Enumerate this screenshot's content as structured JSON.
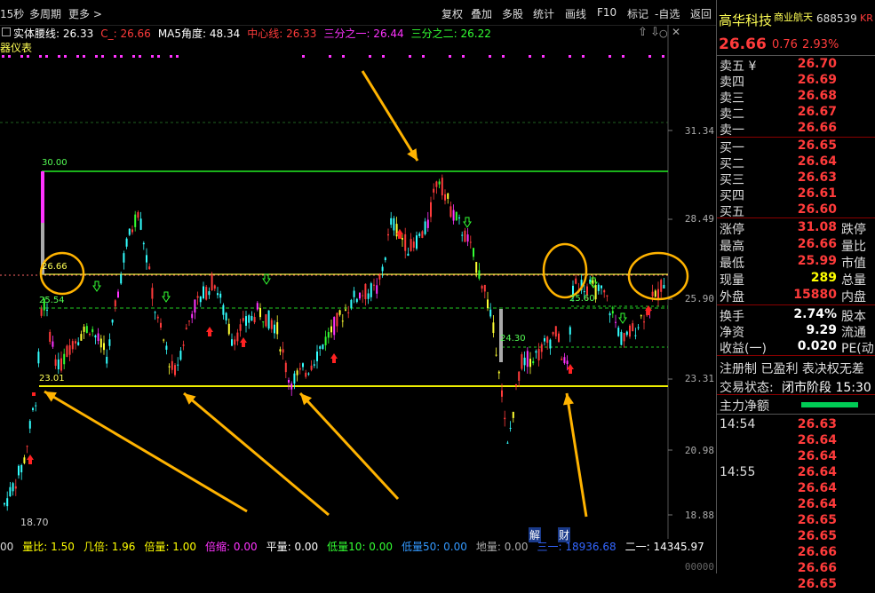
{
  "topbar": {
    "period": "15秒",
    "multi_period": "多周期",
    "more": "更多 >",
    "menu": [
      "复权",
      "叠加",
      "多股",
      "统计",
      "画线",
      "F10",
      "标记",
      "-自选",
      "返回"
    ]
  },
  "legend": {
    "items": [
      {
        "text": "实体腰线: 26.33",
        "color": "#ffffff"
      },
      {
        "text": "C_: 26.66",
        "color": "#ff3b3b"
      },
      {
        "text": "MA5角度: 48.34",
        "color": "#ffffff"
      },
      {
        "text": "中心线: 26.33",
        "color": "#ff3b3b"
      },
      {
        "text": "三分之一: 26.44",
        "color": "#ff33ff"
      },
      {
        "text": "三分之二: 26.22",
        "color": "#33ff33"
      }
    ],
    "panel_name": "器仪表"
  },
  "price_axis": [
    "31.34",
    "28.49",
    "25.90",
    "23.31",
    "20.98",
    "18.88"
  ],
  "price_axis_partial": "00000",
  "annotations": {
    "line_30": "30.00",
    "line_2666": "26.66",
    "line_2554": "25.54",
    "line_2301": "23.01",
    "low_1870": "18.70",
    "label_2430": "24.30",
    "label_2560": "25.60",
    "jie": "解",
    "cai": "财"
  },
  "bottombar": {
    "items": [
      {
        "text": "00",
        "color": "#dddddd"
      },
      {
        "text": "量比: 1.50",
        "color": "#ffff00"
      },
      {
        "text": "几倍: 1.96",
        "color": "#ffff00"
      },
      {
        "text": "倍量: 1.00",
        "color": "#ffff00"
      },
      {
        "text": "倍缩: 0.00",
        "color": "#ff33ff"
      },
      {
        "text": "平量: 0.00",
        "color": "#ffffff"
      },
      {
        "text": "低量10: 0.00",
        "color": "#33ff33"
      },
      {
        "text": "低量50: 0.00",
        "color": "#3399ff"
      },
      {
        "text": "地量: 0.00",
        "color": "#aaaaaa"
      },
      {
        "text": "三一: 18936.68",
        "color": "#3366ff"
      },
      {
        "text": "二一: 14345.97",
        "color": "#ffffff"
      }
    ]
  },
  "stock": {
    "name": "高华科技",
    "sector": "商业航天",
    "code": "688539",
    "suffix": "KR",
    "price": "26.66",
    "change": "0.76",
    "pct": "2.93%"
  },
  "orderbook": {
    "asks": [
      {
        "label": "卖五 ¥",
        "price": "26.70"
      },
      {
        "label": "卖四",
        "price": "26.69"
      },
      {
        "label": "卖三",
        "price": "26.68"
      },
      {
        "label": "卖二",
        "price": "26.67"
      },
      {
        "label": "卖一",
        "price": "26.66"
      }
    ],
    "bids": [
      {
        "label": "买一",
        "price": "26.65"
      },
      {
        "label": "买二",
        "price": "26.64"
      },
      {
        "label": "买三",
        "price": "26.63"
      },
      {
        "label": "买四",
        "price": "26.61"
      },
      {
        "label": "买五",
        "price": "26.60"
      }
    ]
  },
  "stats": [
    {
      "label": "涨停",
      "value": "31.08",
      "extra": "跌停",
      "color": "#ff3b3b"
    },
    {
      "label": "最高",
      "value": "26.66",
      "extra": "量比",
      "color": "#ff3b3b"
    },
    {
      "label": "最低",
      "value": "25.99",
      "extra": "市值",
      "color": "#ff3b3b"
    },
    {
      "label": "现量",
      "value": "289",
      "extra": "总量",
      "color": "#ffff00"
    },
    {
      "label": "外盘",
      "value": "15880",
      "extra": "内盘",
      "color": "#ff3b3b"
    }
  ],
  "stats2": [
    {
      "label": "换手",
      "value": "2.74%",
      "extra": "股本",
      "color": "#ffffff"
    },
    {
      "label": "净资",
      "value": "9.29",
      "extra": "流通",
      "color": "#ffffff"
    },
    {
      "label": "收益(一)",
      "value": "0.020",
      "extra": "PE(动)",
      "color": "#ffffff"
    }
  ],
  "notice": "注册制 已盈利 表决权无差",
  "trade_state": {
    "label": "交易状态:",
    "value": "闭市阶段 15:30"
  },
  "main_flow": "主力净额",
  "ticks": [
    {
      "time": "14:54",
      "price": "26.63"
    },
    {
      "time": "",
      "price": "26.64"
    },
    {
      "time": "",
      "price": "26.64"
    },
    {
      "time": "14:55",
      "price": "26.64"
    },
    {
      "time": "",
      "price": "26.64"
    },
    {
      "time": "",
      "price": "26.64"
    },
    {
      "time": "",
      "price": "26.65"
    },
    {
      "time": "",
      "price": "26.65"
    },
    {
      "time": "",
      "price": "26.66"
    },
    {
      "time": "",
      "price": "26.66"
    },
    {
      "time": "",
      "price": "26.65"
    }
  ]
}
